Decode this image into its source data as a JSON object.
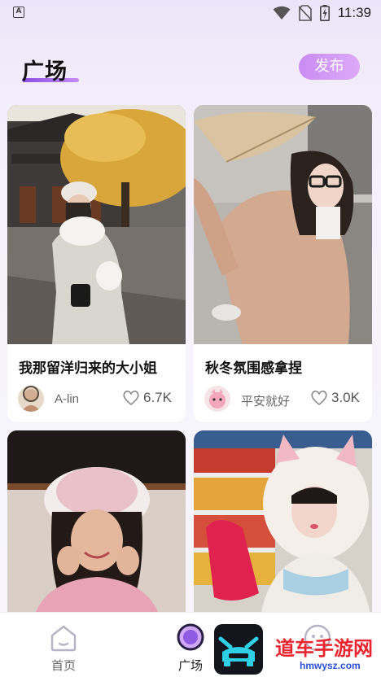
{
  "status_bar": {
    "left_icon_letter": "A",
    "time": "11:39",
    "icons": [
      "notification-a-icon",
      "wifi-icon",
      "no-sim-icon",
      "battery-charging-icon"
    ]
  },
  "header": {
    "title": "广场",
    "publish_label": "发布"
  },
  "posts": [
    {
      "title": "我那留洋归来的大小姐",
      "author": "A-lin",
      "likes": "6.7K"
    },
    {
      "title": "秋冬氛围感拿捏",
      "author": "平安就好",
      "likes": "3.0K"
    },
    {
      "title": "",
      "author": "",
      "likes": ""
    },
    {
      "title": "",
      "author": "",
      "likes": ""
    }
  ],
  "bottom_nav": {
    "items": [
      {
        "label": "首页",
        "icon": "home-icon",
        "active": false
      },
      {
        "label": "广场",
        "icon": "plaza-circle-icon",
        "active": true
      },
      {
        "label": "",
        "icon": "profile-icon",
        "active": false
      }
    ]
  },
  "watermark": {
    "text": "道车手游网",
    "url": "hmwysz.com"
  },
  "colors": {
    "accent": "#9b5de5",
    "publish_gradient_start": "#c98cf2",
    "publish_gradient_end": "#dcaaf8",
    "watermark_red": "#e8252f"
  }
}
